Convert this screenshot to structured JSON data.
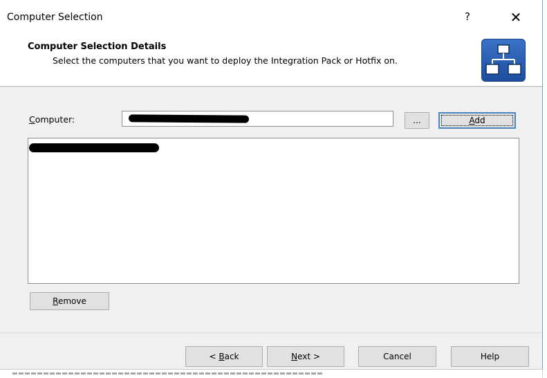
{
  "window": {
    "title": "Computer Selection",
    "help_glyph": "?",
    "close_glyph": "✕"
  },
  "header": {
    "title": "Computer Selection Details",
    "subtitle": "Select the computers that you want to deploy the Integration Pack or Hotfix on.",
    "icon": "network-topology-icon",
    "icon_color": "#2a5fb4"
  },
  "form": {
    "computer_label_hotkey": "C",
    "computer_label_rest": "omputer:",
    "computer_value": "",
    "browse_label": "...",
    "add_label_hotkey": "A",
    "add_label_rest": "dd"
  },
  "list": {
    "items": []
  },
  "actions": {
    "remove_hotkey": "R",
    "remove_rest": "emove"
  },
  "footer": {
    "back_prefix": "< ",
    "back_hotkey": "B",
    "back_rest": "ack",
    "next_hotkey": "N",
    "next_rest": "ext >",
    "cancel_label": "Cancel",
    "help_label": "Help"
  }
}
